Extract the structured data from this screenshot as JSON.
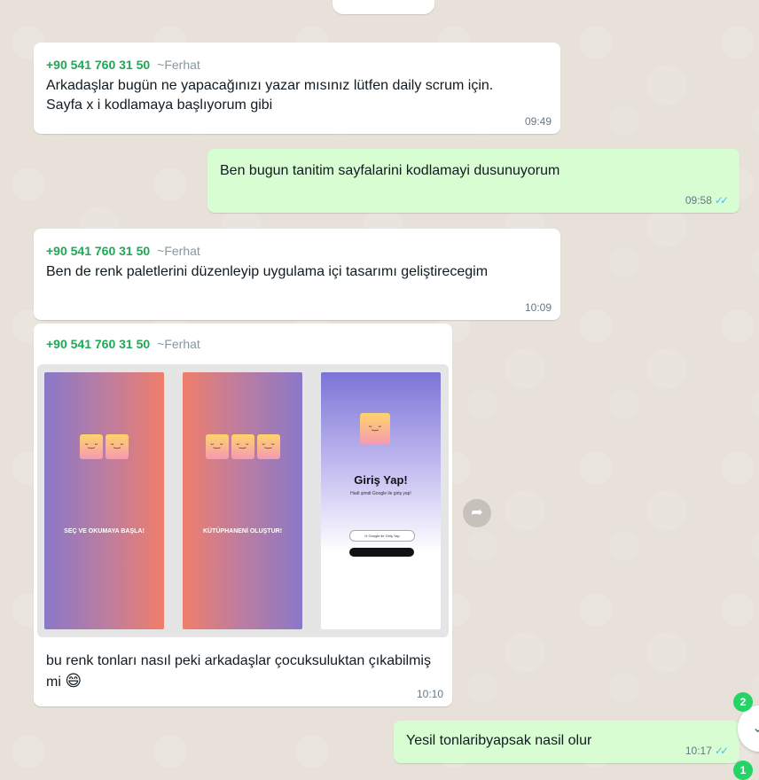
{
  "messages": [
    {
      "sender_phone": "+90 541 760 31 50",
      "sender_name": "~Ferhat",
      "text": "Arkadaşlar bugün ne yapacağınızı yazar mısınız lütfen daily scrum için. Sayfa x i kodlamaya başlıyorum gibi",
      "time": "09:49"
    },
    {
      "text": "Ben bugun tanitim sayfalarini kodlamayi dusunuyorum",
      "time": "09:58",
      "status_icon": "double-check-icon"
    },
    {
      "sender_phone": "+90 541 760 31 50",
      "sender_name": "~Ferhat",
      "text": "Ben de renk paletlerini düzenleyip uygulama içi tasarımı geliştirecegim",
      "time": "10:09"
    },
    {
      "sender_phone": "+90 541 760 31 50",
      "sender_name": "~Ferhat",
      "caption": "bu renk tonları nasıl peki arkadaşlar çocuksuluktan çıkabilmiş mi",
      "emoji": "😄",
      "time": "10:10",
      "screens": [
        {
          "title": "SEÇ VE OKUMAYA BAŞLA!"
        },
        {
          "title": "KÜTÜPHANENİ OLUŞTUR!"
        },
        {
          "title": "Giriş Yap!",
          "subtitle": "Hadi şimdi Google ile giriş yap!",
          "google_button": "Google ile Giriş Yap"
        }
      ]
    },
    {
      "text": "Yesil tonlaribyapsak nasil olur",
      "time": "10:17",
      "status_icon": "double-check-icon"
    }
  ],
  "badges": [
    "2",
    "1"
  ],
  "colors": {
    "background": "#e7e1d9",
    "incoming": "#ffffff",
    "outgoing": "#d9fdd3",
    "sender": "#1fa855",
    "read_tick": "#53bdeb"
  }
}
